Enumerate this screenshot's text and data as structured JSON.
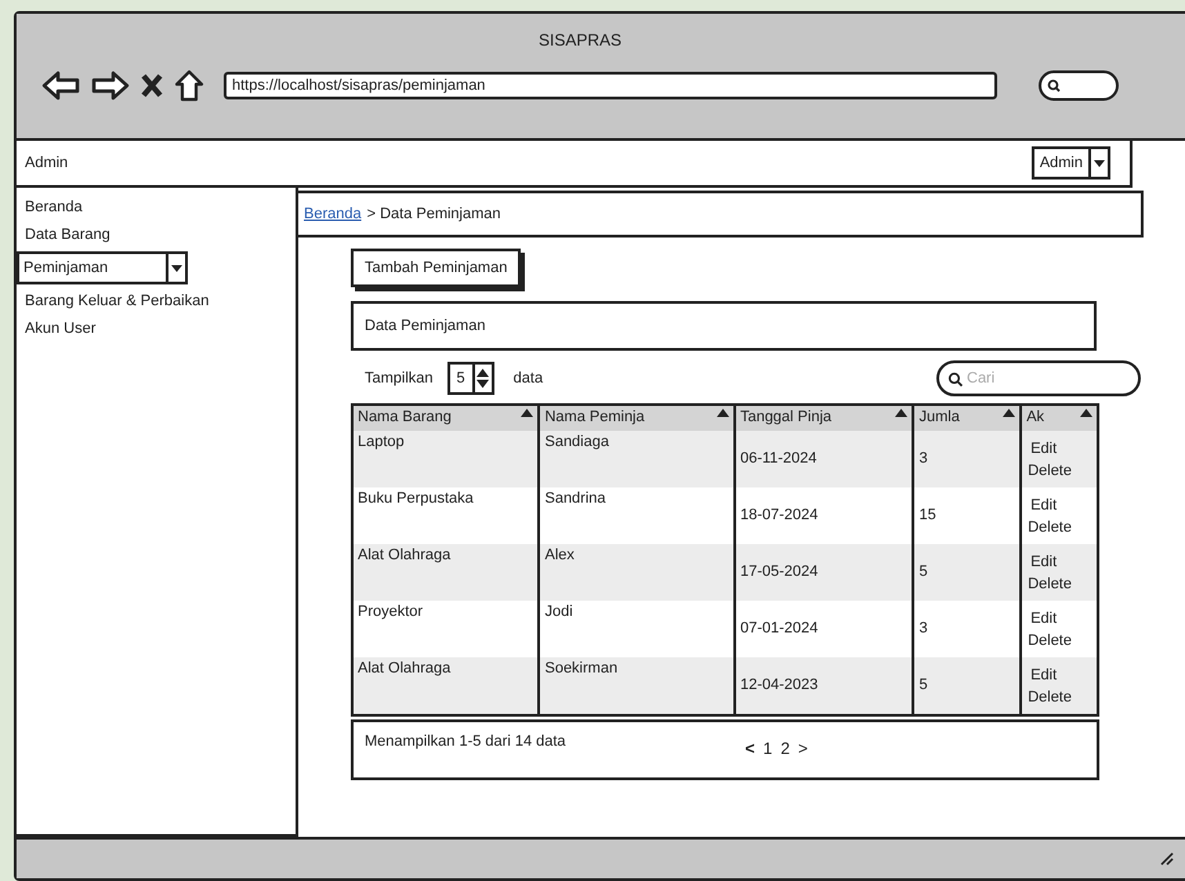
{
  "window": {
    "title": "SISAPRAS",
    "url": "https://localhost/sisapras/peminjaman"
  },
  "top_bar": {
    "title": "Admin",
    "user_menu": "Admin"
  },
  "sidebar": {
    "items": [
      {
        "label": "Beranda",
        "kind": "link"
      },
      {
        "label": "Data Barang",
        "kind": "link"
      },
      {
        "label": "Peminjaman",
        "kind": "dropdown"
      },
      {
        "label": "Barang Keluar & Perbaikan",
        "kind": "link"
      },
      {
        "label": "Akun User",
        "kind": "link"
      }
    ]
  },
  "breadcrumb": {
    "link": "Beranda",
    "current": "> Data Peminjaman"
  },
  "add_button": "Tambah Peminjaman",
  "panel_title": "Data Peminjaman",
  "page_size": {
    "prefix": "Tampilkan",
    "value": "5",
    "suffix": "data"
  },
  "search": {
    "placeholder": "Cari"
  },
  "table": {
    "columns": [
      "Nama Barang",
      "Nama Peminja",
      "Tanggal Pinja",
      "Jumla",
      "Ak"
    ],
    "rows": [
      {
        "cells": [
          "Laptop",
          "Sandiaga",
          "06-11-2024",
          "3"
        ],
        "actions": [
          "Edit",
          "Delete"
        ]
      },
      {
        "cells": [
          "Buku Perpustaka",
          "Sandrina",
          "18-07-2024",
          "15"
        ],
        "actions": [
          "Edit",
          "Delete"
        ]
      },
      {
        "cells": [
          "Alat Olahraga",
          "Alex",
          "17-05-2024",
          "5"
        ],
        "actions": [
          "Edit",
          "Delete"
        ]
      },
      {
        "cells": [
          "Proyektor",
          "Jodi",
          "07-01-2024",
          "3"
        ],
        "actions": [
          "Edit",
          "Delete"
        ]
      },
      {
        "cells": [
          "Alat Olahraga",
          "Soekirman",
          "12-04-2023",
          "5"
        ],
        "actions": [
          "Edit",
          "Delete"
        ]
      }
    ]
  },
  "footer": {
    "summary": "Menampilkan 1-5 dari 14 data",
    "prev": "<",
    "pages": [
      "1",
      "2"
    ],
    "next": ">"
  }
}
